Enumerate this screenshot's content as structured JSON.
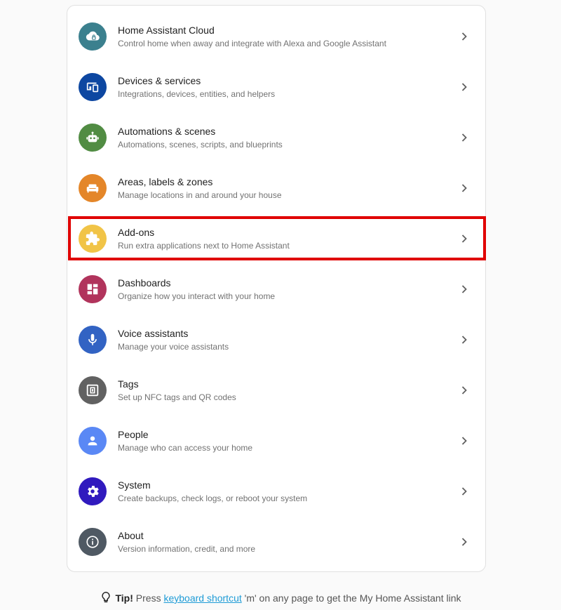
{
  "menu": {
    "items": [
      {
        "title": "Home Assistant Cloud",
        "subtitle": "Control home when away and integrate with Alexa and Google Assistant",
        "icon": "cloud-lock-icon",
        "color": "#3b808e"
      },
      {
        "title": "Devices & services",
        "subtitle": "Integrations, devices, entities, and helpers",
        "icon": "devices-icon",
        "color": "#0d47a1"
      },
      {
        "title": "Automations & scenes",
        "subtitle": "Automations, scenes, scripts, and blueprints",
        "icon": "robot-icon",
        "color": "#518c43"
      },
      {
        "title": "Areas, labels & zones",
        "subtitle": "Manage locations in and around your house",
        "icon": "sofa-icon",
        "color": "#e48629"
      },
      {
        "title": "Add-ons",
        "subtitle": "Run extra applications next to Home Assistant",
        "icon": "puzzle-icon",
        "color": "#f1c447"
      },
      {
        "title": "Dashboards",
        "subtitle": "Organize how you interact with your home",
        "icon": "dashboard-icon",
        "color": "#b1345c"
      },
      {
        "title": "Voice assistants",
        "subtitle": "Manage your voice assistants",
        "icon": "microphone-icon",
        "color": "#3263c3"
      },
      {
        "title": "Tags",
        "subtitle": "Set up NFC tags and QR codes",
        "icon": "nfc-tag-icon",
        "color": "#616161"
      },
      {
        "title": "People",
        "subtitle": "Manage who can access your home",
        "icon": "account-icon",
        "color": "#5a88f5"
      },
      {
        "title": "System",
        "subtitle": "Create backups, check logs, or reboot your system",
        "icon": "gear-icon",
        "color": "#301ABE"
      },
      {
        "title": "About",
        "subtitle": "Version information, credit, and more",
        "icon": "info-icon",
        "color": "#4f5963"
      }
    ]
  },
  "tip": {
    "label": "Tip!",
    "prefix": "Press",
    "link": "keyboard shortcut",
    "suffix": "'m' on any page to get the My Home Assistant link"
  },
  "highlight": {
    "color": "#e00000",
    "target": "Add-ons"
  }
}
